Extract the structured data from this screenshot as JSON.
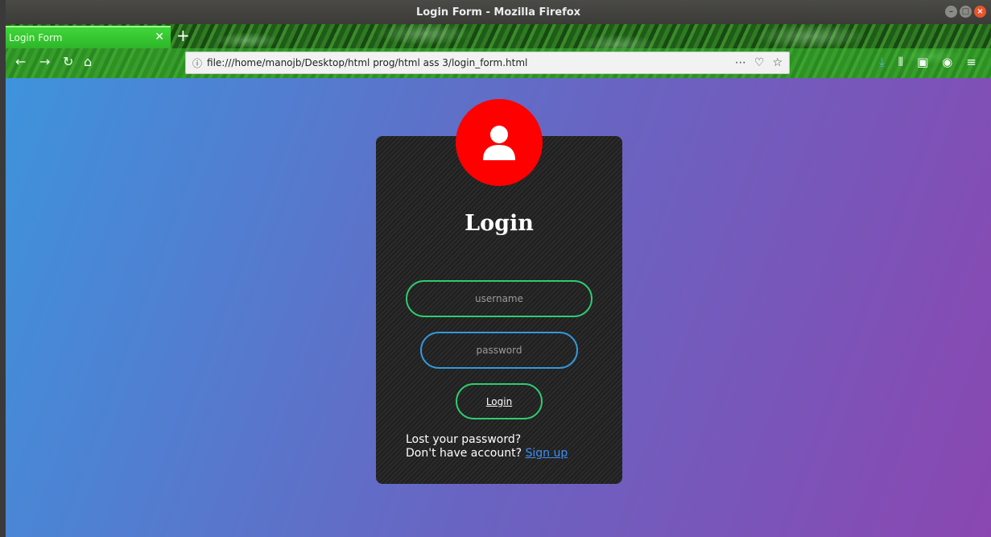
{
  "window": {
    "title": "Login Form - Mozilla Firefox"
  },
  "browser": {
    "tab_title": "Login Form",
    "url": "file:///home/manojb/Desktop/html prog/html ass 3/login_form.html"
  },
  "icons": {
    "back": "arrow-left-icon",
    "forward": "arrow-right-icon",
    "reload": "reload-icon",
    "home": "home-icon",
    "page_actions": "ellipsis-icon",
    "pocket": "pocket-icon",
    "bookmark": "star-icon",
    "downloads": "download-icon",
    "library": "library-icon",
    "sidebar": "sidebar-icon",
    "account": "account-icon",
    "menu": "hamburger-menu-icon",
    "avatar": "user-icon"
  },
  "colors": {
    "avatar_bg": "#ff0000",
    "username_border": "#2ecc71",
    "password_border": "#3498db",
    "button_border": "#2ecc71",
    "link": "#3d8ff0",
    "gradient_start": "#3e93dc",
    "gradient_end": "#8a47b1"
  },
  "form": {
    "title": "Login",
    "username_placeholder": "username",
    "password_placeholder": "password",
    "submit_label": "Login",
    "lost_password": "Lost your password?",
    "no_account": "Don't have account?",
    "signup_label": "Sign up"
  }
}
